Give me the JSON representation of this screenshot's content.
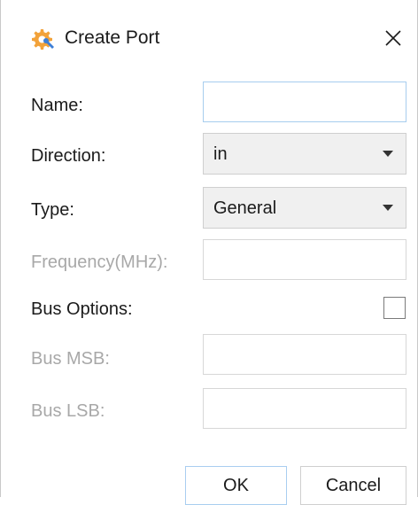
{
  "window": {
    "title": "Create Port",
    "icon": "gear-wrench-icon",
    "close_icon": "close-icon"
  },
  "form": {
    "name_label": "Name:",
    "name_value": "",
    "direction_label": "Direction:",
    "direction_value": "in",
    "type_label": "Type:",
    "type_value": "General",
    "frequency_label": "Frequency(MHz):",
    "frequency_value": "",
    "bus_options_label": "Bus Options:",
    "bus_options_checked": false,
    "bus_msb_label": "Bus MSB:",
    "bus_msb_value": "",
    "bus_lsb_label": "Bus LSB:",
    "bus_lsb_value": ""
  },
  "buttons": {
    "ok_label": "OK",
    "cancel_label": "Cancel"
  },
  "colors": {
    "focus_border": "#a7cdee",
    "disabled_text": "#a8a8a8",
    "icon_orange": "#f2a23a",
    "icon_blue": "#3d7fd6"
  }
}
